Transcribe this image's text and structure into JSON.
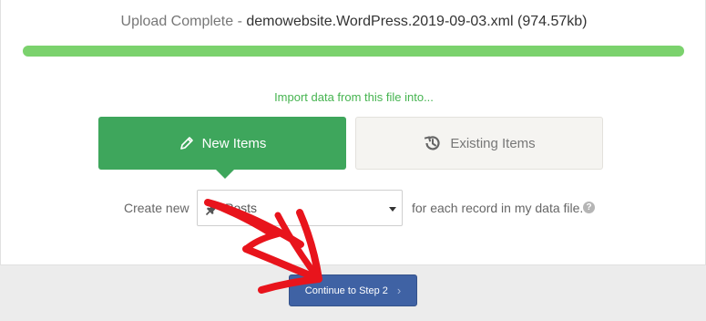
{
  "upload": {
    "status_label": "Upload Complete",
    "separator": " - ",
    "filename": "demowebsite.WordPress.2019-09-03.xml",
    "size": "(974.57kb)",
    "progress_percent": 100,
    "progress_color": "#7bd26d"
  },
  "import": {
    "prompt": "Import data from this file into...",
    "options": [
      {
        "label": "New Items",
        "icon": "pencil-icon",
        "selected": true
      },
      {
        "label": "Existing Items",
        "icon": "history-icon",
        "selected": false
      }
    ],
    "accent_color": "#3ea65c"
  },
  "create_row": {
    "prefix": "Create new",
    "post_type_value": "Posts",
    "post_type_icon": "pin-icon",
    "suffix": "for each record in my data file.",
    "help_icon": "question-icon",
    "help_glyph": "?"
  },
  "footer": {
    "continue_label": "Continue to Step 2",
    "continue_chevron": "›",
    "button_color": "#3f62a4"
  },
  "annotation": {
    "arrow_color": "#e8141c"
  }
}
